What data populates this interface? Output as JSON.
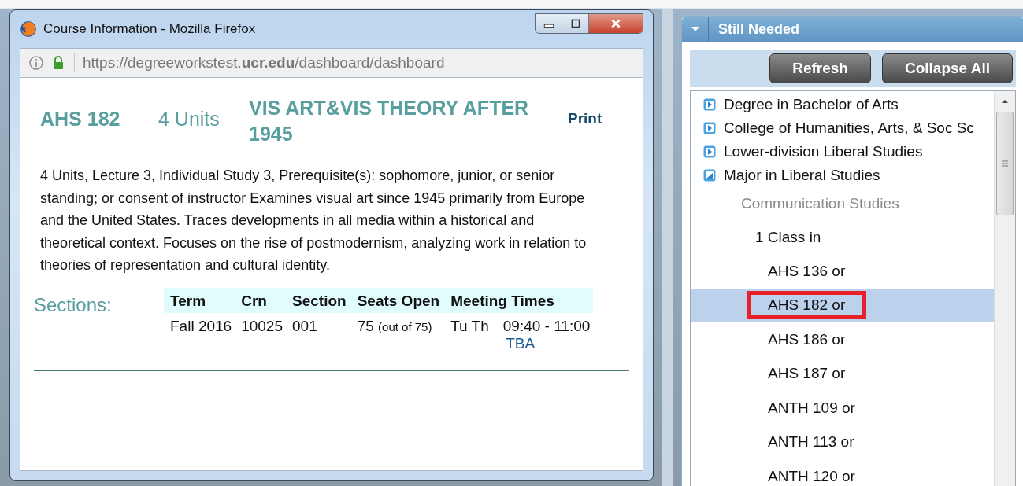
{
  "popup": {
    "title": "Course Information - Mozilla Firefox",
    "url": "https://degreeworkstest.**ucr.edu**/dashboard/dashboard",
    "course": {
      "code": "AHS 182",
      "units": "4 Units",
      "name": "VIS ART&VIS THEORY AFTER 1945",
      "print": "Print",
      "description": "4 Units, Lecture 3, Individual Study 3, Prerequisite(s): sophomore, junior, or senior standing; or consent of instructor Examines visual art since 1945 primarily from Europe and the United States. Traces developments in all media within a historical and theoretical context. Focuses on the rise of postmodernism, analyzing work in relation to theories of representation and cultural identity.",
      "sections_label": "Sections:",
      "columns": [
        "Term",
        "Crn",
        "Section",
        "Seats Open",
        "Meeting Times"
      ],
      "rows": [
        {
          "term": "Fall 2016",
          "crn": "10025",
          "section": "001",
          "seats": "75",
          "seats_total": "(out of 75)",
          "days": "Tu Th",
          "time": "09:40 - 11:00",
          "location": "TBA"
        }
      ]
    }
  },
  "panel": {
    "title": "Still Needed",
    "expanded": true,
    "buttons": [
      "Refresh",
      "Collapse All"
    ],
    "tree": [
      {
        "label": "Degree in Bachelor of Arts",
        "kind": "block",
        "expanded": false
      },
      {
        "label": "College of Humanities, Arts, & Soc Sc",
        "kind": "block",
        "expanded": false
      },
      {
        "label": "Lower-division Liberal Studies",
        "kind": "block",
        "expanded": false
      },
      {
        "label": "Major in Liberal Studies",
        "kind": "block",
        "expanded": true,
        "children": [
          {
            "label": "Communication Studies",
            "kind": "heading",
            "children": [
              {
                "label": "1 Class in",
                "kind": "rule",
                "children": [
                  {
                    "label": "AHS 136 or",
                    "kind": "course",
                    "selected": false,
                    "circled": false
                  },
                  {
                    "label": "AHS 182 or",
                    "kind": "course",
                    "selected": true,
                    "circled": true
                  },
                  {
                    "label": "AHS 186 or",
                    "kind": "course",
                    "selected": false,
                    "circled": false
                  },
                  {
                    "label": "AHS 187 or",
                    "kind": "course",
                    "selected": false,
                    "circled": false
                  },
                  {
                    "label": "ANTH 109 or",
                    "kind": "course",
                    "selected": false,
                    "circled": false
                  },
                  {
                    "label": "ANTH 113 or",
                    "kind": "course",
                    "selected": false,
                    "circled": false
                  },
                  {
                    "label": "ANTH 120 or",
                    "kind": "course",
                    "selected": false,
                    "circled": false
                  }
                ]
              }
            ]
          }
        ]
      }
    ]
  }
}
